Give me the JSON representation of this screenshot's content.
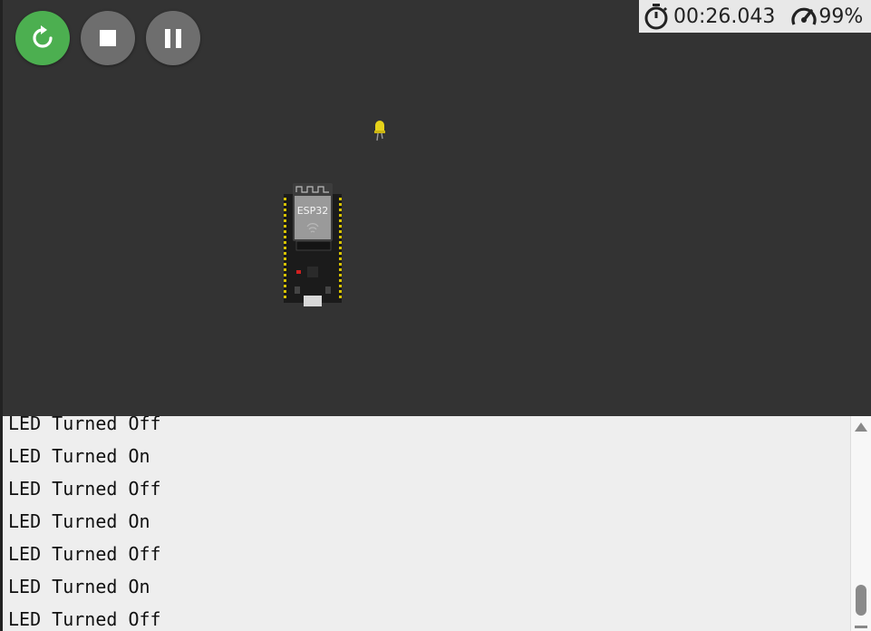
{
  "controls": {
    "restart": {
      "icon": "restart-icon",
      "color": "#4caf50"
    },
    "stop": {
      "icon": "stop-icon",
      "color": "#6e6e6e"
    },
    "pause": {
      "icon": "pause-icon",
      "color": "#6e6e6e"
    }
  },
  "stats": {
    "timer": "00:26.043",
    "timer_icon": "stopwatch-icon",
    "speed": "99%",
    "speed_icon": "speedometer-icon"
  },
  "canvas": {
    "board_label": "ESP32",
    "led_color": "#e6d21a"
  },
  "serial_monitor": {
    "lines": [
      "LED Turned Off",
      "LED Turned On",
      "LED Turned Off",
      "LED Turned On",
      "LED Turned Off",
      "LED Turned On",
      "LED Turned Off"
    ]
  }
}
